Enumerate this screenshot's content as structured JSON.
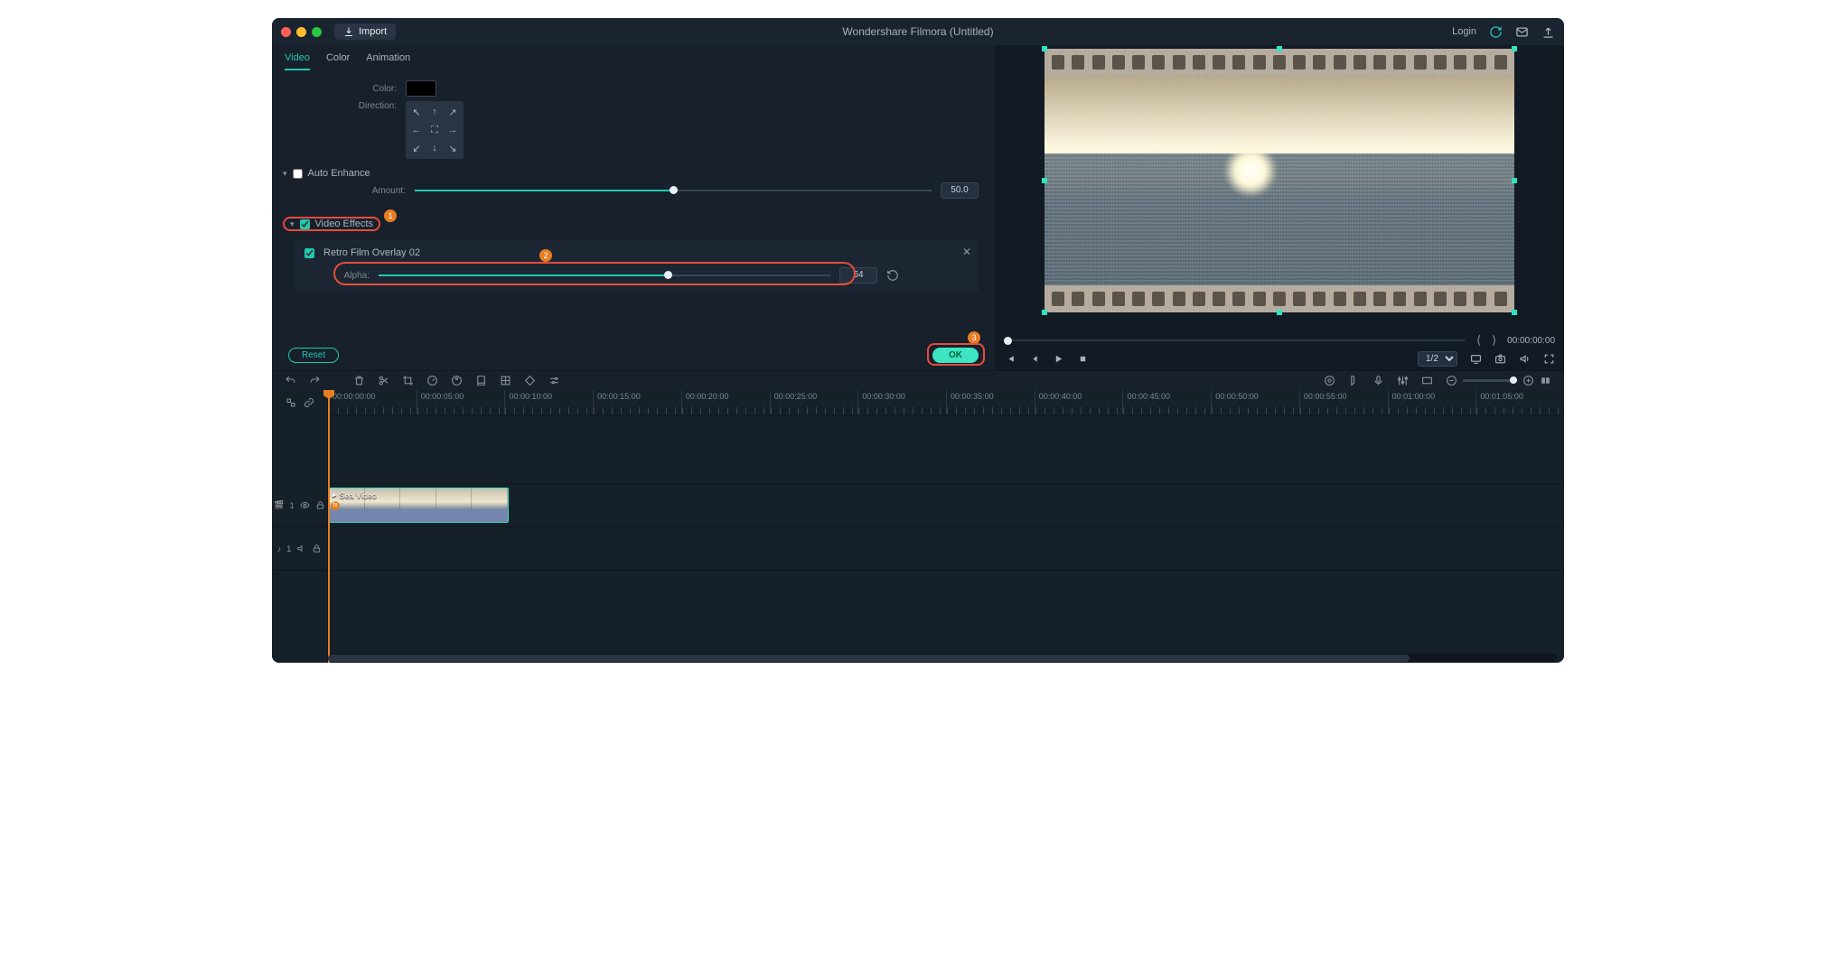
{
  "titlebar": {
    "app_title": "Wondershare Filmora (Untitled)",
    "import": "Import",
    "login": "Login"
  },
  "tabs": {
    "video": "Video",
    "color": "Color",
    "animation": "Animation"
  },
  "props": {
    "color_label": "Color:",
    "direction_label": "Direction:",
    "auto_enhance": "Auto Enhance",
    "amount_label": "Amount:",
    "amount_val": "50.0",
    "video_effects": "Video Effects",
    "effect_name": "Retro Film Overlay 02",
    "alpha_label": "Alpha:",
    "alpha_val": "64"
  },
  "actions": {
    "reset": "Reset",
    "ok": "OK"
  },
  "annotations": {
    "n1": "1",
    "n2": "2",
    "n3": "3"
  },
  "preview": {
    "timecode": "00:00:00:00",
    "scale": "1/2"
  },
  "timeline": {
    "ticks": [
      "00:00:00:00",
      "00:00:05:00",
      "00:00:10:00",
      "00:00:15:00",
      "00:00:20:00",
      "00:00:25:00",
      "00:00:30:00",
      "00:00:35:00",
      "00:00:40:00",
      "00:00:45:00",
      "00:00:50:00",
      "00:00:55:00",
      "00:01:00:00",
      "00:01:05:00"
    ],
    "clip_label": "Sea Video",
    "video_track": "1",
    "audio_track": "1"
  }
}
